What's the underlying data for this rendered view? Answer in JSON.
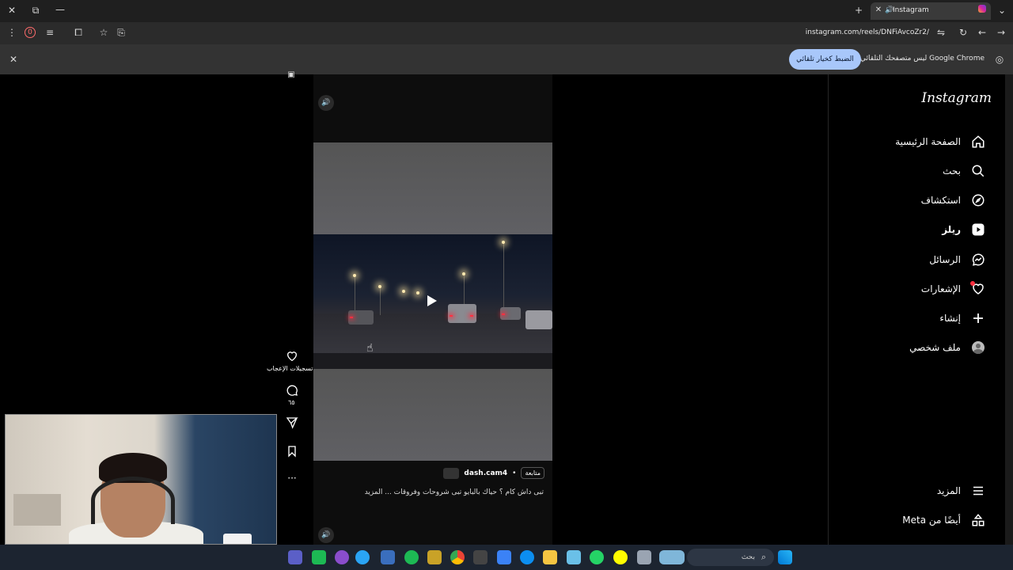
{
  "browser": {
    "tab_title": "Instagram",
    "url": "instagram.com/reels/DNFiAvcoZr2/",
    "extension_badge": "0",
    "infobar_text": "Google Chrome ليس متصفحك التلقائي",
    "infobar_button": "الضبط كخيار تلقائي"
  },
  "sidebar": {
    "logo": "Instagram",
    "items": [
      {
        "label": "الصفحة الرئيسية",
        "icon": "home-icon"
      },
      {
        "label": "بحث",
        "icon": "search-icon"
      },
      {
        "label": "استكشاف",
        "icon": "compass-icon"
      },
      {
        "label": "ريلز",
        "icon": "reels-icon"
      },
      {
        "label": "الرسائل",
        "icon": "messenger-icon"
      },
      {
        "label": "الإشعارات",
        "icon": "heart-icon"
      },
      {
        "label": "إنشاء",
        "icon": "plus-icon"
      },
      {
        "label": "ملف شخصي",
        "icon": "avatar-icon"
      }
    ],
    "more": "المزيد",
    "meta": "أيضًا من Meta"
  },
  "reel": {
    "likes_label": "تسجيلات الإعجاب",
    "comments_count": "٦٥",
    "author": "dash.cam4",
    "follow": "متابعة",
    "caption": "تبى داش كام ؟ حياك بالبايو تبى شروحات وفروقات ... المزيد"
  },
  "taskbar": {
    "search_placeholder": "بحث",
    "webcam_label": "logi"
  },
  "colors": {
    "info_button": "#a8c7fa",
    "notification_dot": "#ff3040",
    "taskbar": "#1c2430"
  }
}
